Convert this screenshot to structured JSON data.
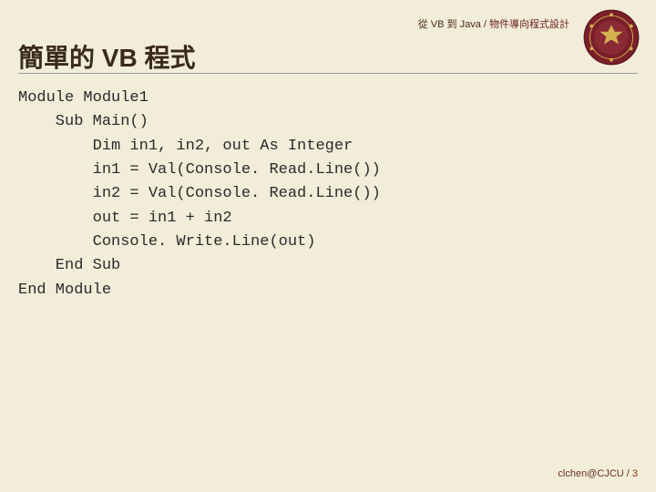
{
  "header": {
    "left": "從 VB 到 Java",
    "sep": " / ",
    "right": "物件導向程式設計"
  },
  "title": "簡單的 VB 程式",
  "code": {
    "l1": "Module Module1",
    "l2": "    Sub Main()",
    "l3": "        Dim in1, in2, out As Integer",
    "l4": "        in1 = Val(Console. Read.Line())",
    "l5": "        in2 = Val(Console. Read.Line())",
    "l6": "        out = in1 + in2",
    "l7": "        Console. Write.Line(out)",
    "l8": "    End Sub",
    "l9": "End Module"
  },
  "footer": {
    "author": "clchen@CJCU",
    "sep": " / ",
    "page": "3"
  },
  "colors": {
    "bg": "#f2edd9",
    "accent": "#6b2020"
  }
}
